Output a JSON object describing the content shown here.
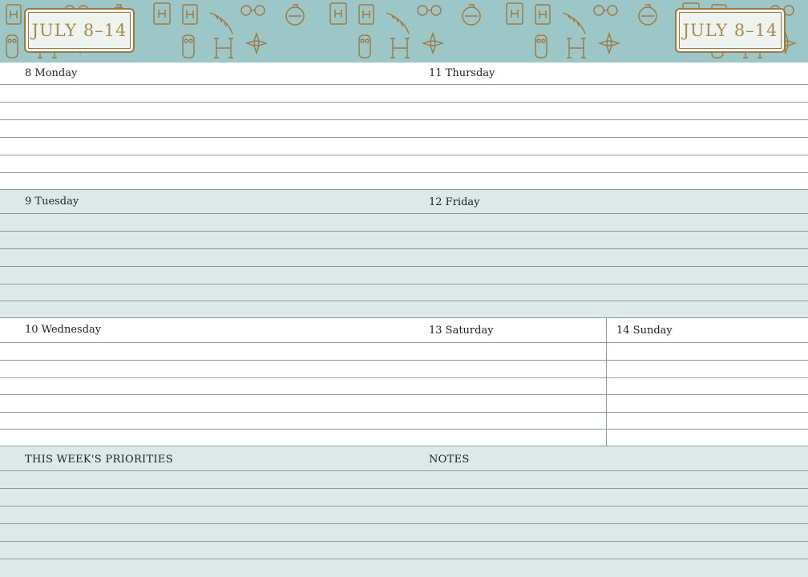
{
  "header": {
    "week_badge_left": "JULY 8–14",
    "week_badge_right": "JULY 8–14",
    "pattern_icons": [
      "book-icon",
      "potion-bottle-icon",
      "glasses-icon",
      "feather-quill-icon",
      "compass-star-icon",
      "letter-h-icon",
      "owl-icon"
    ],
    "colors": {
      "banner": "#9dc6c7",
      "gold": "#9a7a42",
      "badge_bg": "#eef3ef"
    }
  },
  "days": {
    "monday": "8  Monday",
    "tuesday": "9  Tuesday",
    "wednesday": "10  Wednesday",
    "thursday": "11  Thursday",
    "friday": "12  Friday",
    "saturday": "13  Saturday",
    "sunday": "14  Sunday"
  },
  "footer": {
    "priorities": "THIS WEEK'S PRIORITIES",
    "notes": "NOTES"
  },
  "colors": {
    "shaded_rows": "#dde9e9",
    "rule": "#8e9b9b"
  }
}
